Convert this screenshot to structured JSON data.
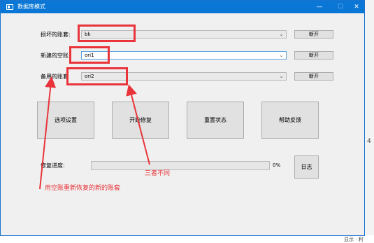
{
  "window": {
    "title": "数据库模式",
    "controls": {
      "minimize": "—",
      "maximize": "☐",
      "close": "✕"
    }
  },
  "form": {
    "good_label": "损坏的账套:",
    "good_value": "bk",
    "new_label": "新建的空账",
    "new_value": "ori1",
    "backup_label": "备用的账套",
    "backup_value": "ori2",
    "disconnect_label": "断开"
  },
  "actions": {
    "options": "选项设置",
    "start": "开始修复",
    "reset": "重置状态",
    "help": "帮助反馈"
  },
  "progress": {
    "label": "修复进度:",
    "percent_text": "0%",
    "value": 0,
    "log_button": "日志"
  },
  "annotations": {
    "different_text": "三者不同",
    "recover_text": "用空账重新恢复的新的账套",
    "color": "#e8343a"
  },
  "background": {
    "right_glyph": "4",
    "bottom_text": "显示 · 利"
  },
  "colors": {
    "titlebar": "#0a77d6",
    "window_bg": "#f0f0f0",
    "progress_fill": "#06b025"
  }
}
